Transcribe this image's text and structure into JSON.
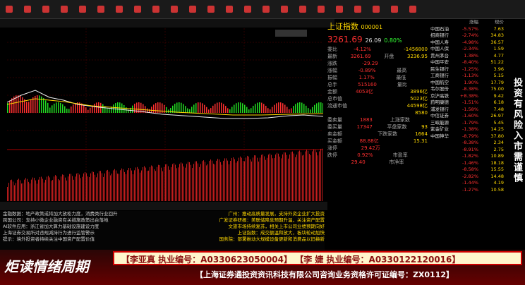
{
  "toolbar": {
    "buttons": [
      "",
      "",
      "",
      "",
      "",
      "",
      "",
      "",
      "",
      "",
      "",
      "",
      "",
      "",
      "",
      "",
      "",
      "",
      "",
      "",
      "",
      "",
      ""
    ]
  },
  "index": {
    "name": "上证指数",
    "code": "000001",
    "price": "3261.69",
    "change": "26.09",
    "change_pct": "0.80%",
    "rows": [
      {
        "k": "委比",
        "v": "-4.12%",
        "k2": "",
        "v2": "-1456800"
      },
      {
        "k": "最新",
        "v": "3261.69",
        "k2": "开盘",
        "v2": "3236.95"
      },
      {
        "k": "涨跌",
        "v": "-29.29",
        "k2": "",
        "v2": ""
      },
      {
        "k": "涨幅",
        "v": "-0.89%",
        "k2": "最高",
        "v2": ""
      },
      {
        "k": "振幅",
        "v": "1.17%",
        "k2": "最低",
        "v2": ""
      },
      {
        "k": "总手",
        "v": "515160",
        "k2": "量比",
        "v2": ""
      },
      {
        "k": "金额",
        "v": "4053亿",
        "k2": "",
        "v2": "3896亿"
      },
      {
        "k": "总市值",
        "v": "",
        "k2": "",
        "v2": "5023亿"
      },
      {
        "k": "流通市值",
        "v": "",
        "k2": "",
        "v2": "44598亿"
      },
      {
        "k": "",
        "v": "",
        "k2": "",
        "v2": "8580"
      },
      {
        "k": "委卖量",
        "v": "1883",
        "k2": "上涨家数",
        "v2": ""
      },
      {
        "k": "委买量",
        "v": "17347",
        "k2": "平盘家数",
        "v2": "93"
      },
      {
        "k": "卖金额",
        "v": "",
        "k2": "下跌家数",
        "v2": "1664"
      },
      {
        "k": "买金额",
        "v": "88.88亿",
        "k2": "",
        "v2": "15.31"
      },
      {
        "k": "涨停",
        "v": "29.42万",
        "k2": "",
        "v2": ""
      },
      {
        "k": "跌停",
        "v": "0.92%",
        "k2": "市盈率",
        "v2": ""
      },
      {
        "k": "",
        "v": "29.40",
        "k2": "市净率",
        "v2": ""
      }
    ]
  },
  "sector": {
    "headers": [
      "",
      "涨幅",
      "现价"
    ],
    "rows": [
      [
        "中国石油",
        "-5.57%",
        "7.63"
      ],
      [
        "招商银行",
        "-2.74%",
        "34.83"
      ],
      [
        "中国人寿",
        "-4.98%",
        "36.57"
      ],
      [
        "中国人保",
        "-2.34%",
        "1.59"
      ],
      [
        "贵州茅台",
        "1.38%",
        "4.77"
      ],
      [
        "中国平安",
        "-8.40%",
        "51.22"
      ],
      [
        "民生银行",
        "-1.25%",
        "3.96"
      ],
      [
        "工商银行",
        "-1.13%",
        "5.15"
      ],
      [
        "中国航空",
        "1.90%",
        "17.79"
      ],
      [
        "韦尔股份",
        "-8.38%",
        "75.00"
      ],
      [
        "京沪高铁",
        "+8.38%",
        "9.42"
      ],
      [
        "药明康德",
        "-1.51%",
        "6.18"
      ],
      [
        "浦发银行",
        "-1.58%",
        "7.48"
      ],
      [
        "中信证券",
        "-1.60%",
        "26.97"
      ],
      [
        "三峡能源",
        "-1.79%",
        "5.45"
      ],
      [
        "紫金矿业",
        "-1.38%",
        "14.25"
      ],
      [
        "中国神华",
        "-8.79%",
        "37.80"
      ],
      [
        "",
        "-8.38%",
        "2.34"
      ],
      [
        "",
        "-8.91%",
        "2.75"
      ],
      [
        "",
        "-1.82%",
        "10.89"
      ],
      [
        "",
        "-1.46%",
        "18.18"
      ],
      [
        "",
        "-8.58%",
        "15.55"
      ],
      [
        "",
        "-2.82%",
        "14.48"
      ],
      [
        "",
        "-1.44%",
        "4.19"
      ],
      [
        "",
        "-1.27%",
        "10.58"
      ]
    ]
  },
  "side_caption": "投资有风险入市需谨慎",
  "news": [
    {
      "text": "金融数据：地产政策或将加大放松力度，消费类行业回升"
    },
    {
      "text": "跨国公司：支持小微企业融资有关措施政策出台落地"
    },
    {
      "text": "AI软件应用：浙江省加大算力基础设施建设力度"
    },
    {
      "text": "上海证券交易所对违规减持行为进行监管警示"
    },
    {
      "text": "提示：境外投资者持续关注中国资产配置价值"
    }
  ],
  "news_right": [
    {
      "text": "广州：推动高质量发展，支持外资企业扩大投资"
    },
    {
      "text": "广发证券研报：美联储降息预期升温，关注资产配置"
    },
    {
      "text": "文旅市场持续复苏，相关上市公司业绩预期向好"
    },
    {
      "text": "上证指数：成交额温和放大，板块轮动加快"
    },
    {
      "text": "国务院：部署推动大规模设备更新和消费品以旧换新"
    }
  ],
  "banner": {
    "logo": "炬读情绪周期",
    "line1": "【李亚真  执业编号：A0330623050004】  【李 婕  执业编号：A0330122120016】",
    "line2": "【上海证券通投资资讯科技有限公司咨询业务资格许可证编号：ZX0112】"
  },
  "colors": {
    "up": "#ff3030",
    "down": "#22dd22",
    "yellow": "#ffd800",
    "bg": "#000000"
  }
}
